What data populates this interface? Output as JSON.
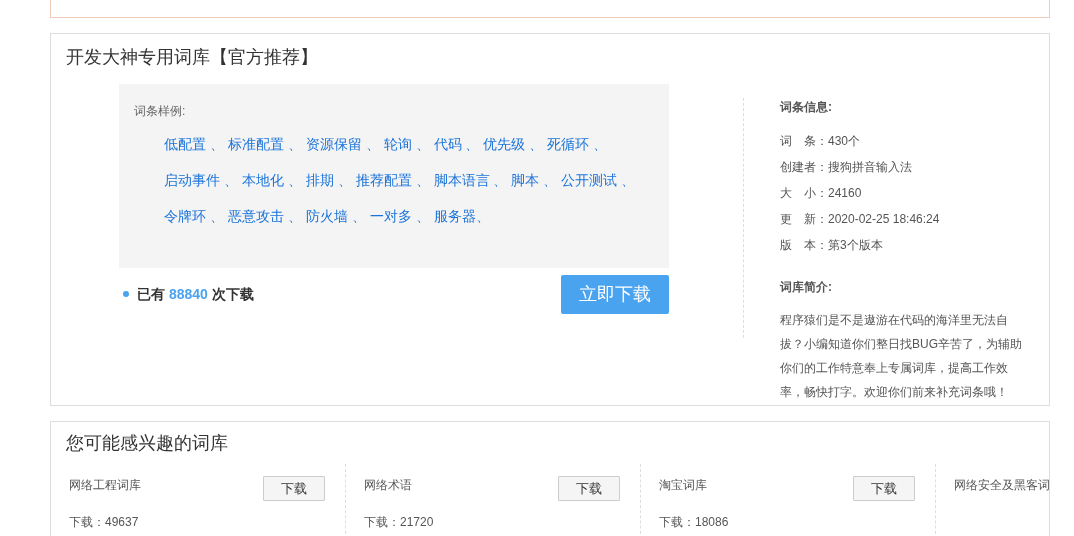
{
  "main": {
    "title": "开发大神专用词库【官方推荐】",
    "sample_label": "词条样例:",
    "sample_lines": [
      [
        "低配置 、",
        "标准配置 、",
        "资源保留 、",
        "轮询 、",
        "代码 、",
        "优先级 、",
        "死循环 、"
      ],
      [
        "启动事件 、",
        "本地化 、",
        "排期 、",
        "推荐配置 、",
        "脚本语言 、",
        "脚本 、",
        "公开测试 、"
      ],
      [
        "令牌环 、",
        "恶意攻击 、",
        "防火墙 、",
        "一对多 、",
        "服务器、"
      ]
    ],
    "downloads": {
      "prefix": "已有",
      "count": "88840",
      "suffix": "次下载"
    },
    "download_button": "立即下载",
    "info_title": "词条信息:",
    "info": [
      "词　条：430个",
      "创建者：搜狗拼音输入法",
      "大　小：24160",
      "更　新：2020-02-25 18:46:24",
      "版　本：第3个版本"
    ],
    "intro_title": "词库简介:",
    "intro": "程序猿们是不是遨游在代码的海洋里无法自拔？小编知道你们整日找BUG辛苦了，为辅助你们的工作特意奉上专属词库，提高工作效率，畅快打字。欢迎你们前来补充词条哦！"
  },
  "related": {
    "title": "您可能感兴趣的词库",
    "items": [
      {
        "name": "网络工程词库",
        "count": "下载：49637",
        "button": "下载"
      },
      {
        "name": "网络术语",
        "count": "下载：21720",
        "button": "下载"
      },
      {
        "name": "淘宝词库",
        "count": "下载：18086",
        "button": "下载"
      },
      {
        "name": "网络安全及黑客词"
      }
    ]
  }
}
